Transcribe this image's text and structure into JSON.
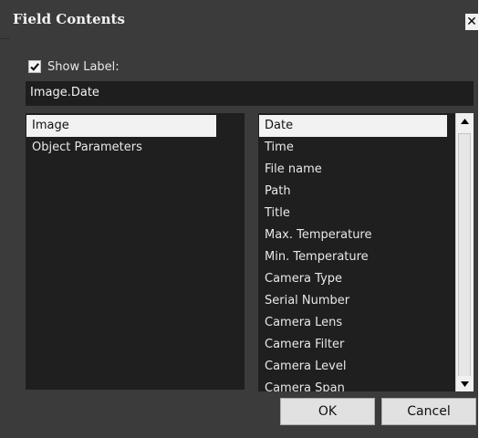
{
  "dialog": {
    "title": "Field Contents",
    "close_label": "✕"
  },
  "show_label": {
    "checked": true,
    "text": "Show Label:"
  },
  "label_field": {
    "value": "Image.Date"
  },
  "left_list": {
    "items": [
      "Image",
      "Object Parameters"
    ],
    "selected": "Image"
  },
  "right_list": {
    "items": [
      "Date",
      "Time",
      "File name",
      "Path",
      "Title",
      "Max. Temperature",
      "Min. Temperature",
      "Camera Type",
      "Serial Number",
      "Camera Lens",
      "Camera Filter",
      "Camera Level",
      "Camera Span"
    ],
    "selected": "Date"
  },
  "buttons": {
    "ok": "OK",
    "cancel": "Cancel"
  },
  "icons": {
    "check": "checkmark-icon",
    "up": "arrow-up-icon",
    "down": "arrow-down-icon",
    "close": "close-icon"
  }
}
